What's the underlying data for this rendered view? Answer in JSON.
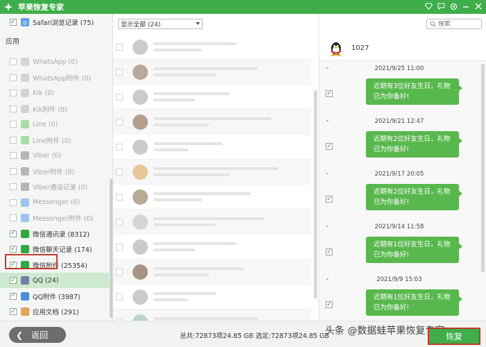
{
  "app": {
    "title": "苹果恢复专家"
  },
  "sidebar": {
    "top_item": {
      "label": "Safari浏览记录 (75)",
      "checked": true
    },
    "group_label": "应用",
    "items": [
      {
        "label": "WhatsApp (0)",
        "icon": "whatsapp-icon",
        "enabled": false,
        "checked": false,
        "color": "#d2d6d2"
      },
      {
        "label": "WhatsApp附件 (0)",
        "icon": "whatsapp-attachment-icon",
        "enabled": false,
        "checked": false,
        "color": "#d2d6d2"
      },
      {
        "label": "Kik (0)",
        "icon": "kik-icon",
        "enabled": false,
        "checked": false,
        "color": "#d2d6d2"
      },
      {
        "label": "Kik附件 (0)",
        "icon": "kik-attachment-icon",
        "enabled": false,
        "checked": false,
        "color": "#d2d6d2"
      },
      {
        "label": "Line (0)",
        "icon": "line-icon",
        "enabled": false,
        "checked": false,
        "color": "#a8dca8"
      },
      {
        "label": "Line附件 (0)",
        "icon": "line-attachment-icon",
        "enabled": false,
        "checked": false,
        "color": "#a8dca8"
      },
      {
        "label": "Viber (0)",
        "icon": "viber-icon",
        "enabled": false,
        "checked": false,
        "color": "#b3b8b3"
      },
      {
        "label": "Viber附件 (0)",
        "icon": "viber-attachment-icon",
        "enabled": false,
        "checked": false,
        "color": "#b3b8b3"
      },
      {
        "label": "Viber通话记录 (0)",
        "icon": "viber-call-icon",
        "enabled": false,
        "checked": false,
        "color": "#b3b8b3"
      },
      {
        "label": "Messenger (0)",
        "icon": "messenger-icon",
        "enabled": false,
        "checked": false,
        "color": "#9cc4ee"
      },
      {
        "label": "Messenger附件 (0)",
        "icon": "messenger-attachment-icon",
        "enabled": false,
        "checked": false,
        "color": "#9cc4ee"
      },
      {
        "label": "微信通讯录 (8312)",
        "icon": "wechat-contacts-icon",
        "enabled": true,
        "checked": true,
        "color": "#2fa843"
      },
      {
        "label": "微信聊天记录 (174)",
        "icon": "wechat-chat-icon",
        "enabled": true,
        "checked": true,
        "color": "#2fa843"
      },
      {
        "label": "微信附件 (25354)",
        "icon": "wechat-attachment-icon",
        "enabled": true,
        "checked": true,
        "color": "#2fa843"
      },
      {
        "label": "QQ (24)",
        "icon": "qq-icon",
        "enabled": true,
        "checked": true,
        "selected": true,
        "color": "#6e7fa8"
      },
      {
        "label": "QQ附件 (3987)",
        "icon": "qq-attachment-icon",
        "enabled": true,
        "checked": true,
        "color": "#4a8fd8"
      },
      {
        "label": "应用文档 (291)",
        "icon": "app-document-icon",
        "enabled": true,
        "checked": true,
        "color": "#e8a35a"
      }
    ]
  },
  "filter": {
    "selected": "显示全部 (24)"
  },
  "search": {
    "placeholder": "搜索"
  },
  "chat": {
    "contact_name": "1027",
    "messages": [
      {
        "time": "2021/9/25 11:00",
        "text": "近期有3位好友生日，礼物已为你备好!"
      },
      {
        "time": "2021/9/21 12:47",
        "text": "近期有2位好友生日，礼物已为你备好!"
      },
      {
        "time": "2021/9/17 20:05",
        "text": "近期有2位好友生日，礼物已为你备好!"
      },
      {
        "time": "2021/9/14 11:58",
        "text": "近期有1位好友生日，礼物已为你备好!"
      },
      {
        "time": "2021/9/9 15:03",
        "text": "近期有1位好友生日，礼物已为你备好!"
      }
    ]
  },
  "footer": {
    "back_label": "返回",
    "summary": "总共:72873项24.85 GB 选定:72873项24.85 GB",
    "recover_label": "恢复",
    "watermark": "头条 @数据蛙苹果恢复专家"
  },
  "colors": {
    "brand_green": "#3fae4a",
    "bubble_green": "#58b84d",
    "highlight_red": "#c0392b"
  }
}
